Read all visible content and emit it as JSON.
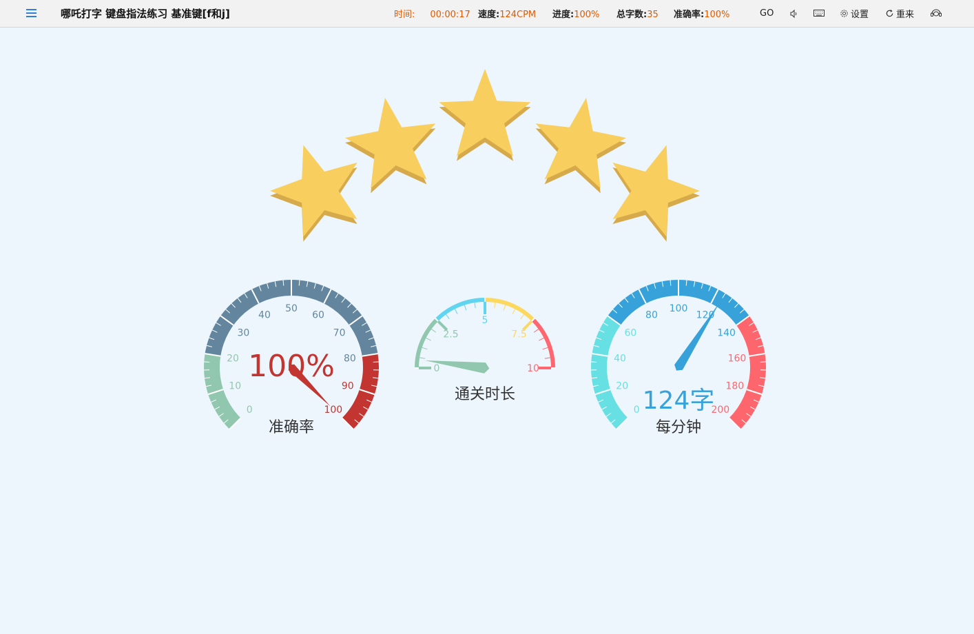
{
  "header": {
    "title": "哪吒打字 键盘指法练习 基准键[f和j]",
    "stats": {
      "time_label": "时间:",
      "time_value": "00:00:17",
      "speed_label": "速度:",
      "speed_value": "124CPM",
      "progress_label": "进度:",
      "progress_value": "100%",
      "total_label": "总字数:",
      "total_value": "35",
      "accuracy_label": "准确率:",
      "accuracy_value": "100%"
    },
    "tools": {
      "go_label": "GO",
      "settings_label": "设置",
      "restart_label": "重来"
    },
    "icons": [
      "menu-icon",
      "sound-icon",
      "keyboard-icon",
      "gear-icon",
      "refresh-icon",
      "support-icon"
    ]
  },
  "rating": {
    "stars": 5,
    "max": 5,
    "color": "#f8cf5f"
  },
  "gauges": {
    "accuracy": {
      "value": 100,
      "min": 0,
      "max": 100,
      "ticks": [
        "0",
        "10",
        "20",
        "30",
        "40",
        "50",
        "60",
        "70",
        "80",
        "90",
        "100"
      ],
      "value_text": "100%",
      "title": "准确率",
      "colors": {
        "low": "#91c7ae",
        "mid": "#63869e",
        "high": "#c23531"
      }
    },
    "duration": {
      "value": 0.4,
      "min": 0,
      "max": 10,
      "ticks": [
        "0",
        "2.5",
        "5",
        "7.5",
        "10"
      ],
      "title": "通关时长",
      "colors": {
        "low": "#91c7ae",
        "mid": "#61d4f0",
        "warn": "#fdd85e",
        "high": "#ff6670"
      }
    },
    "speed": {
      "value": 124,
      "min": 0,
      "max": 200,
      "ticks": [
        "0",
        "20",
        "40",
        "60",
        "80",
        "100",
        "120",
        "140",
        "160",
        "180",
        "200"
      ],
      "value_text": "124字",
      "title": "每分钟",
      "colors": {
        "low": "#67e0e3",
        "mid": "#37a2da",
        "high": "#fd666d"
      }
    }
  }
}
